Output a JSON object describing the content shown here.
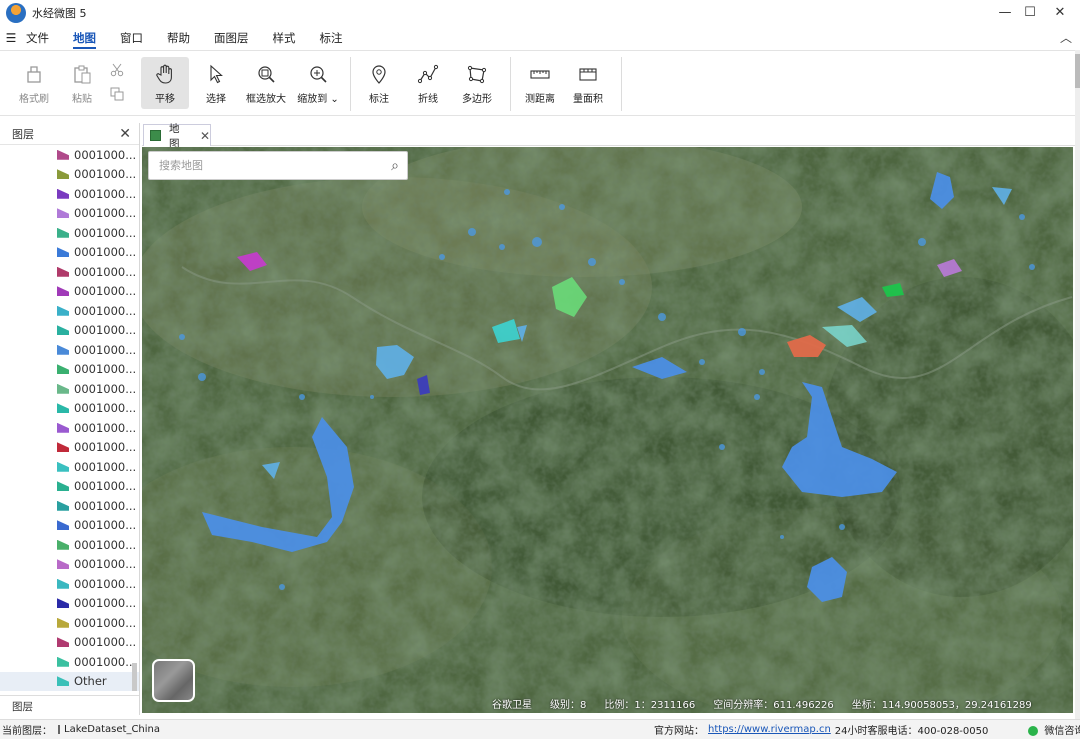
{
  "app": {
    "title": "水经微图 5"
  },
  "window": {
    "minimize": "—",
    "maximize": "☐",
    "close": "✕"
  },
  "menu": {
    "items": [
      "文件",
      "地图",
      "窗口",
      "帮助",
      "面图层",
      "样式",
      "标注"
    ],
    "active": "地图"
  },
  "ribbon": {
    "format_brush": "格式刷",
    "paste": "粘贴",
    "pan": "平移",
    "select": "选择",
    "zoom_box": "框选放大",
    "zoom_to": "缩放到",
    "marker": "标注",
    "polyline": "折线",
    "polygon": "多边形",
    "measure_distance": "测距离",
    "measure_area": "量面积"
  },
  "layer_panel": {
    "title": "图层",
    "footer_tab": "图层",
    "layers": [
      {
        "label": "0001000...",
        "color": "#b04a8a"
      },
      {
        "label": "0001000...",
        "color": "#8a9a3a"
      },
      {
        "label": "0001000...",
        "color": "#7a3ac0"
      },
      {
        "label": "0001000...",
        "color": "#b07ad8"
      },
      {
        "label": "0001000...",
        "color": "#3ab08a"
      },
      {
        "label": "0001000...",
        "color": "#3a7ad8"
      },
      {
        "label": "0001000...",
        "color": "#b03a6a"
      },
      {
        "label": "0001000...",
        "color": "#a03ab8"
      },
      {
        "label": "0001000...",
        "color": "#3ab0c8"
      },
      {
        "label": "0001000...",
        "color": "#2ab0a0"
      },
      {
        "label": "0001000...",
        "color": "#4a8ad8"
      },
      {
        "label": "0001000...",
        "color": "#3ab070"
      },
      {
        "label": "0001000...",
        "color": "#6ab88a"
      },
      {
        "label": "0001000...",
        "color": "#2ab8a8"
      },
      {
        "label": "0001000...",
        "color": "#9a5ad0"
      },
      {
        "label": "0001000...",
        "color": "#c02a3a"
      },
      {
        "label": "0001000...",
        "color": "#3ac0c0"
      },
      {
        "label": "0001000...",
        "color": "#2ab090"
      },
      {
        "label": "0001000...",
        "color": "#2aa0a0"
      },
      {
        "label": "0001000...",
        "color": "#3a6ad0"
      },
      {
        "label": "0001000...",
        "color": "#4ab06a"
      },
      {
        "label": "0001000...",
        "color": "#b86ac8"
      },
      {
        "label": "0001000...",
        "color": "#3ab8c0"
      },
      {
        "label": "0001000...",
        "color": "#2a2aa8"
      },
      {
        "label": "0001000...",
        "color": "#b8a83a"
      },
      {
        "label": "0001000...",
        "color": "#b03a70"
      },
      {
        "label": "0001000...",
        "color": "#3ac0a0"
      },
      {
        "label": "Other",
        "color": "#3ac0b8"
      }
    ],
    "selected": "Other"
  },
  "map_tab": {
    "label": "地图",
    "close": "✕"
  },
  "search": {
    "placeholder": "搜索地图"
  },
  "map_status": {
    "source": "谷歌卫星",
    "level": "级别：8",
    "scale": "比例：1：2311166",
    "resolution": "空间分辨率：611.496226",
    "coords": "坐标：114.90058053，29.24161289"
  },
  "statusbar": {
    "current_layer_label": "当前图层：",
    "current_layer": "LakeDataset_China",
    "site_label": "官方网站：",
    "site_url": "https://www.rivermap.cn",
    "hotline": "24小时客服电话：400-028-0050",
    "wechat": "微信咨询"
  },
  "colors": {
    "accent": "#1a57b8",
    "lake_blue": "#4b8fe8",
    "lake_orange": "#e06a4a"
  }
}
